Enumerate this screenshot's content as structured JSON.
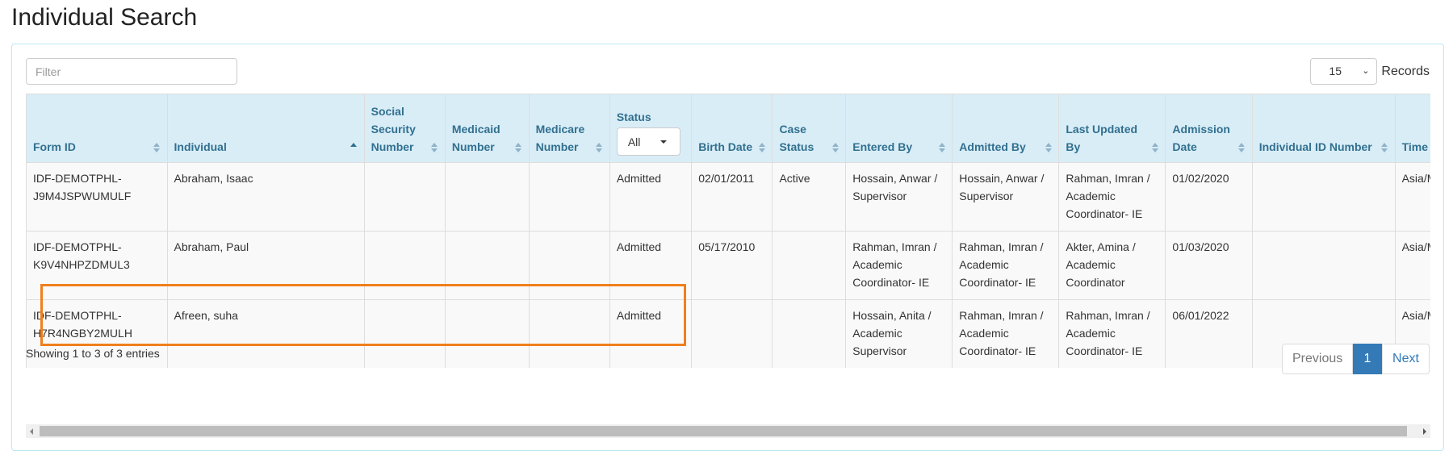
{
  "page": {
    "title": "Individual Search"
  },
  "toolbar": {
    "filter_placeholder": "Filter",
    "filter_value": "",
    "records_value": "15",
    "records_label": "Records"
  },
  "table": {
    "columns": [
      {
        "label": "Form ID",
        "sort": "none"
      },
      {
        "label": "Individual",
        "sort": "asc"
      },
      {
        "label": "Social Security Number",
        "sort": "none"
      },
      {
        "label": "Medicaid Number",
        "sort": "none"
      },
      {
        "label": "Medicare Number",
        "sort": "none"
      },
      {
        "label": "Status",
        "sort": "none",
        "filter_value": "All"
      },
      {
        "label": "Birth Date",
        "sort": "none"
      },
      {
        "label": "Case Status",
        "sort": "none"
      },
      {
        "label": "Entered By",
        "sort": "none"
      },
      {
        "label": "Admitted By",
        "sort": "none"
      },
      {
        "label": "Last Updated By",
        "sort": "none"
      },
      {
        "label": "Admission Date",
        "sort": "none"
      },
      {
        "label": "Individual ID Number",
        "sort": "none"
      },
      {
        "label": "Time Zone",
        "sort": "none"
      }
    ],
    "rows": [
      {
        "form_id": "IDF-DEMOTPHL-J9M4JSPWUMULF",
        "individual": "Abraham, Isaac",
        "ssn": "",
        "medicaid": "",
        "medicare": "",
        "status": "Admitted",
        "birth_date": "02/01/2011",
        "case_status": "Active",
        "entered_by": "Hossain, Anwar / Supervisor",
        "admitted_by": "Hossain, Anwar / Supervisor",
        "last_updated_by": "Rahman, Imran / Academic Coordinator- IE",
        "admission_date": "01/02/2020",
        "individual_id": "",
        "time_zone": "Asia/Manila"
      },
      {
        "form_id": "IDF-DEMOTPHL-K9V4NHPZDMUL3",
        "individual": "Abraham, Paul",
        "ssn": "",
        "medicaid": "",
        "medicare": "",
        "status": "Admitted",
        "birth_date": "05/17/2010",
        "case_status": "",
        "entered_by": "Rahman, Imran / Academic Coordinator- IE",
        "admitted_by": "Rahman, Imran / Academic Coordinator- IE",
        "last_updated_by": "Akter, Amina / Academic Coordinator",
        "admission_date": "01/03/2020",
        "individual_id": "",
        "time_zone": "Asia/Manila"
      },
      {
        "form_id": "IDF-DEMOTPHL-H7R4NGBY2MULH",
        "individual": "Afreen, suha",
        "ssn": "",
        "medicaid": "",
        "medicare": "",
        "status": "Admitted",
        "birth_date": "",
        "case_status": "",
        "entered_by": "Hossain, Anita / Academic Supervisor",
        "admitted_by": "Rahman, Imran / Academic Coordinator- IE",
        "last_updated_by": "Rahman, Imran / Academic Coordinator- IE",
        "admission_date": "06/01/2022",
        "individual_id": "",
        "time_zone": "Asia/Manila"
      }
    ],
    "highlighted_row": 1
  },
  "footer": {
    "showing": "Showing 1 to 3 of 3 entries",
    "pagination": {
      "previous": "Previous",
      "current": "1",
      "next": "Next"
    }
  },
  "colors": {
    "header_bg": "#d9edf7",
    "header_text": "#31708f",
    "highlight": "#f07f1d",
    "active_page": "#337ab7"
  }
}
